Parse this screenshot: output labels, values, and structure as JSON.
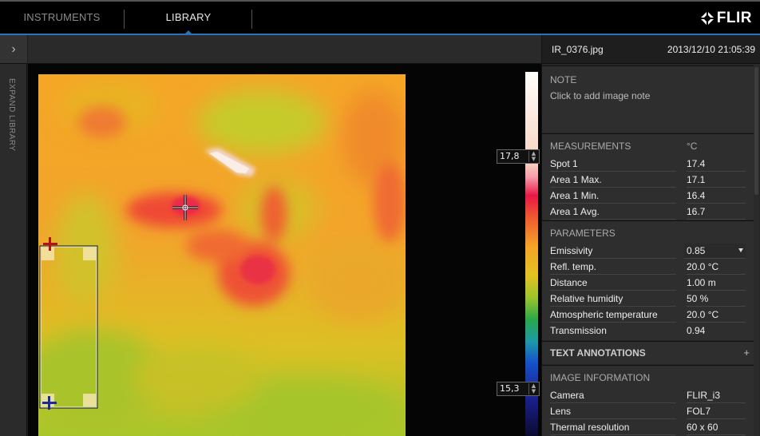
{
  "nav": {
    "tabs": [
      {
        "label": "INSTRUMENTS",
        "active": false
      },
      {
        "label": "LIBRARY",
        "active": true
      }
    ],
    "brand": "FLIR",
    "accent_color": "#2a73b8"
  },
  "library": {
    "expand_label": "EXPAND LIBRARY",
    "expand_icon": "chevron-right-icon"
  },
  "image": {
    "filename": "IR_0376.jpg",
    "timestamp": "2013/12/10 21:05:39",
    "scale_max": "17,8",
    "scale_min": "15,3"
  },
  "note": {
    "title": "NOTE",
    "placeholder": "Click to add image note"
  },
  "measurements": {
    "title": "MEASUREMENTS",
    "unit": "°C",
    "rows": [
      {
        "label": "Spot 1",
        "value": "17.4"
      },
      {
        "label": "Area 1 Max.",
        "value": "17.1"
      },
      {
        "label": "Area 1 Min.",
        "value": "16.4"
      },
      {
        "label": "Area 1 Avg.",
        "value": "16.7"
      }
    ]
  },
  "parameters": {
    "title": "PARAMETERS",
    "rows": [
      {
        "label": "Emissivity",
        "value": "0.85"
      },
      {
        "label": "Refl. temp.",
        "value": "20.0 °C"
      },
      {
        "label": "Distance",
        "value": "1.00 m"
      },
      {
        "label": "Relative humidity",
        "value": "50 %"
      },
      {
        "label": "Atmospheric temperature",
        "value": "20.0 °C"
      },
      {
        "label": "Transmission",
        "value": "0.94"
      }
    ]
  },
  "text_annotations": {
    "title": "TEXT ANNOTATIONS",
    "add_label": "+"
  },
  "image_information": {
    "title": "IMAGE INFORMATION",
    "rows": [
      {
        "label": "Camera",
        "value": "FLIR_i3"
      },
      {
        "label": "Lens",
        "value": "FOL7"
      },
      {
        "label": "Thermal resolution",
        "value": "60 x 60"
      }
    ]
  }
}
